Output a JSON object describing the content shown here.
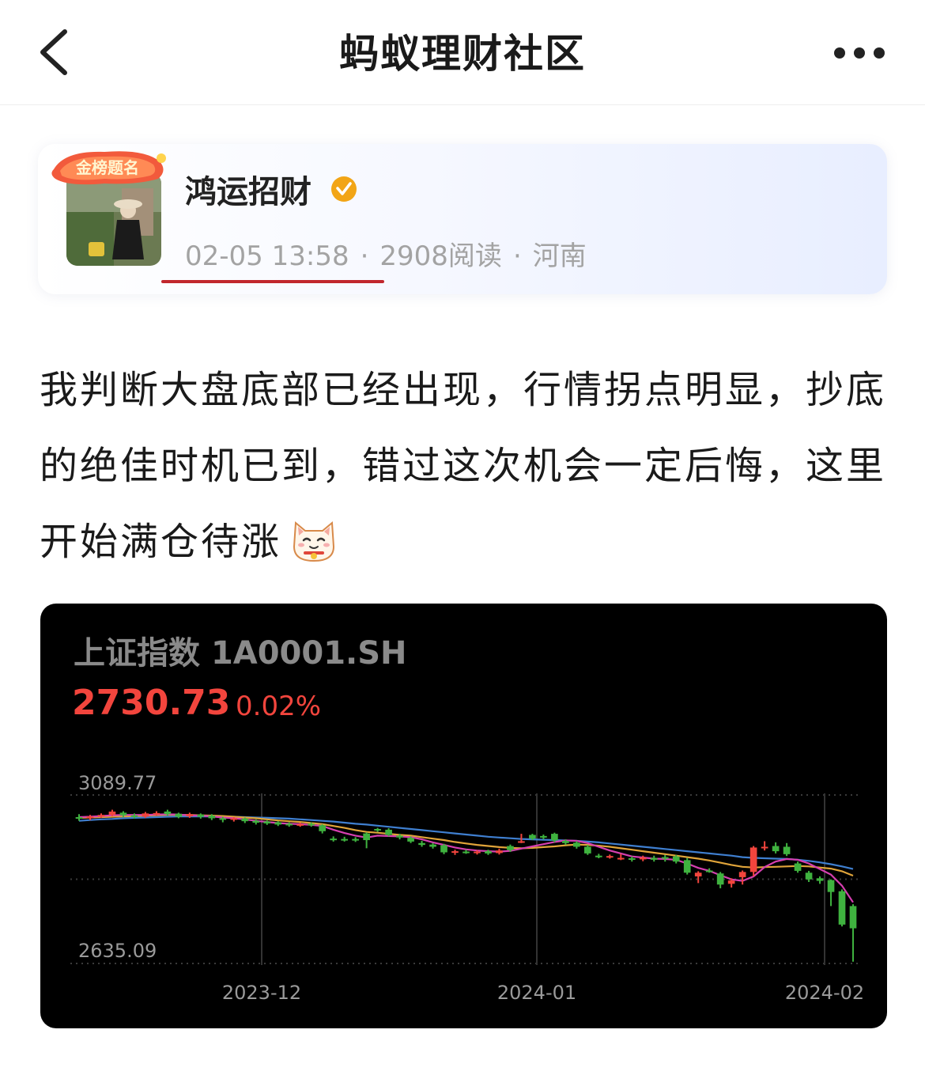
{
  "nav": {
    "title": "蚂蚁理财社区"
  },
  "author": {
    "name": "鸿运招财",
    "badge_text": "金榜题名",
    "date": "02-05 13:58",
    "reads": "2908阅读",
    "location": "河南"
  },
  "post": {
    "text": "我判断大盘底部已经出现，行情拐点明显，抄底的绝佳时机已到，错过这次机会一定后悔，这里开始满仓待涨"
  },
  "stock": {
    "name": "上证指数",
    "code": "1A0001.SH",
    "price": "2730.73",
    "change": "0.02%"
  },
  "colors": {
    "up": "#f2453d",
    "down": "#3fb23f",
    "accent_underline": "#c1272d",
    "ma5": "#d63fb0",
    "ma10": "#e0a43a",
    "ma20": "#3f7fd0"
  },
  "chart_data": {
    "type": "candlestick",
    "y_labels": [
      "3089.77",
      "2635.09"
    ],
    "x_labels": [
      "2023-12",
      "2024-01",
      "2024-02"
    ],
    "ylim": [
      2635.09,
      3089.77
    ],
    "candles": [
      {
        "o": 3030,
        "c": 3027,
        "h": 3038,
        "l": 3020
      },
      {
        "o": 3027,
        "c": 3032,
        "h": 3036,
        "l": 3022
      },
      {
        "o": 3033,
        "c": 3036,
        "h": 3040,
        "l": 3028
      },
      {
        "o": 3036,
        "c": 3045,
        "h": 3050,
        "l": 3032
      },
      {
        "o": 3042,
        "c": 3035,
        "h": 3046,
        "l": 3030
      },
      {
        "o": 3035,
        "c": 3031,
        "h": 3040,
        "l": 3026
      },
      {
        "o": 3031,
        "c": 3040,
        "h": 3044,
        "l": 3028
      },
      {
        "o": 3039,
        "c": 3041,
        "h": 3046,
        "l": 3034
      },
      {
        "o": 3045,
        "c": 3038,
        "h": 3050,
        "l": 3034
      },
      {
        "o": 3039,
        "c": 3031,
        "h": 3042,
        "l": 3027
      },
      {
        "o": 3032,
        "c": 3038,
        "h": 3042,
        "l": 3028
      },
      {
        "o": 3037,
        "c": 3031,
        "h": 3040,
        "l": 3026
      },
      {
        "o": 3034,
        "c": 3027,
        "h": 3038,
        "l": 3022
      },
      {
        "o": 3027,
        "c": 3024,
        "h": 3031,
        "l": 3016
      },
      {
        "o": 3024,
        "c": 3027,
        "h": 3030,
        "l": 3018
      },
      {
        "o": 3026,
        "c": 3019,
        "h": 3029,
        "l": 3014
      },
      {
        "o": 3020,
        "c": 3015,
        "h": 3024,
        "l": 3010
      },
      {
        "o": 3018,
        "c": 3013,
        "h": 3021,
        "l": 3009
      },
      {
        "o": 3016,
        "c": 3010,
        "h": 3019,
        "l": 3006
      },
      {
        "o": 3012,
        "c": 3009,
        "h": 3016,
        "l": 3004
      },
      {
        "o": 3010,
        "c": 3011,
        "h": 3015,
        "l": 3004
      },
      {
        "o": 3012,
        "c": 3008,
        "h": 3016,
        "l": 3004
      },
      {
        "o": 3008,
        "c": 2992,
        "h": 3011,
        "l": 2986
      },
      {
        "o": 2972,
        "c": 2970,
        "h": 2978,
        "l": 2964
      },
      {
        "o": 2971,
        "c": 2969,
        "h": 2977,
        "l": 2964
      },
      {
        "o": 2971,
        "c": 2968,
        "h": 2976,
        "l": 2963
      },
      {
        "o": 2986,
        "c": 2968,
        "h": 2989,
        "l": 2946
      },
      {
        "o": 2998,
        "c": 2996,
        "h": 3001,
        "l": 2990
      },
      {
        "o": 2996,
        "c": 2982,
        "h": 3000,
        "l": 2978
      },
      {
        "o": 2980,
        "c": 2975,
        "h": 2985,
        "l": 2970
      },
      {
        "o": 2974,
        "c": 2964,
        "h": 2978,
        "l": 2960
      },
      {
        "o": 2960,
        "c": 2955,
        "h": 2966,
        "l": 2950
      },
      {
        "o": 2956,
        "c": 2950,
        "h": 2960,
        "l": 2945
      },
      {
        "o": 2954,
        "c": 2935,
        "h": 2958,
        "l": 2930
      },
      {
        "o": 2936,
        "c": 2938,
        "h": 2942,
        "l": 2928
      },
      {
        "o": 2937,
        "c": 2936,
        "h": 2942,
        "l": 2931
      },
      {
        "o": 2934,
        "c": 2937,
        "h": 2941,
        "l": 2929
      },
      {
        "o": 2938,
        "c": 2932,
        "h": 2942,
        "l": 2928
      },
      {
        "o": 2933,
        "c": 2940,
        "h": 2945,
        "l": 2929
      },
      {
        "o": 2952,
        "c": 2941,
        "h": 2956,
        "l": 2936
      },
      {
        "o": 2962,
        "c": 2965,
        "h": 2985,
        "l": 2960
      },
      {
        "o": 2982,
        "c": 2972,
        "h": 2985,
        "l": 2968
      },
      {
        "o": 2979,
        "c": 2976,
        "h": 2983,
        "l": 2970
      },
      {
        "o": 2985,
        "c": 2967,
        "h": 2988,
        "l": 2962
      },
      {
        "o": 2966,
        "c": 2960,
        "h": 2970,
        "l": 2955
      },
      {
        "o": 2961,
        "c": 2950,
        "h": 2965,
        "l": 2945
      },
      {
        "o": 2950,
        "c": 2932,
        "h": 2955,
        "l": 2928
      },
      {
        "o": 2926,
        "c": 2924,
        "h": 2931,
        "l": 2919
      },
      {
        "o": 2923,
        "c": 2925,
        "h": 2929,
        "l": 2918
      },
      {
        "o": 2917,
        "c": 2920,
        "h": 2931,
        "l": 2914
      },
      {
        "o": 2919,
        "c": 2915,
        "h": 2924,
        "l": 2910
      },
      {
        "o": 2916,
        "c": 2921,
        "h": 2926,
        "l": 2911
      },
      {
        "o": 2920,
        "c": 2915,
        "h": 2926,
        "l": 2910
      },
      {
        "o": 2922,
        "c": 2920,
        "h": 2928,
        "l": 2910
      },
      {
        "o": 2924,
        "c": 2910,
        "h": 2928,
        "l": 2905
      },
      {
        "o": 2914,
        "c": 2880,
        "h": 2920,
        "l": 2875
      },
      {
        "o": 2870,
        "c": 2880,
        "h": 2884,
        "l": 2852
      },
      {
        "o": 2886,
        "c": 2884,
        "h": 2892,
        "l": 2880
      },
      {
        "o": 2878,
        "c": 2848,
        "h": 2882,
        "l": 2838
      },
      {
        "o": 2850,
        "c": 2859,
        "h": 2865,
        "l": 2840
      },
      {
        "o": 2868,
        "c": 2882,
        "h": 2886,
        "l": 2848
      },
      {
        "o": 2882,
        "c": 2948,
        "h": 2952,
        "l": 2870
      },
      {
        "o": 2948,
        "c": 2950,
        "h": 2965,
        "l": 2940
      },
      {
        "o": 2952,
        "c": 2938,
        "h": 2962,
        "l": 2932
      },
      {
        "o": 2950,
        "c": 2930,
        "h": 2960,
        "l": 2925
      },
      {
        "o": 2905,
        "c": 2885,
        "h": 2910,
        "l": 2880
      },
      {
        "o": 2880,
        "c": 2862,
        "h": 2885,
        "l": 2855
      },
      {
        "o": 2865,
        "c": 2858,
        "h": 2870,
        "l": 2850
      },
      {
        "o": 2860,
        "c": 2828,
        "h": 2862,
        "l": 2790
      },
      {
        "o": 2830,
        "c": 2740,
        "h": 2835,
        "l": 2735
      },
      {
        "o": 2790,
        "c": 2730,
        "h": 2795,
        "l": 2640
      }
    ],
    "ma5": [
      3030,
      3031,
      3033,
      3035,
      3036,
      3036,
      3036,
      3037,
      3038,
      3037,
      3035,
      3034,
      3032,
      3029,
      3027,
      3024,
      3020,
      3017,
      3014,
      3012,
      3011,
      3009,
      3006,
      2996,
      2987,
      2980,
      2975,
      2980,
      2979,
      2978,
      2976,
      2970,
      2962,
      2955,
      2948,
      2943,
      2940,
      2938,
      2937,
      2939,
      2945,
      2951,
      2957,
      2963,
      2967,
      2966,
      2960,
      2950,
      2940,
      2932,
      2924,
      2921,
      2918,
      2917,
      2915,
      2905,
      2893,
      2885,
      2873,
      2862,
      2858,
      2870,
      2895,
      2910,
      2917,
      2915,
      2905,
      2890,
      2875,
      2845,
      2800
    ],
    "ma10": [
      3028,
      3029,
      3030,
      3031,
      3032,
      3033,
      3034,
      3035,
      3036,
      3036,
      3036,
      3035,
      3034,
      3033,
      3031,
      3029,
      3027,
      3024,
      3021,
      3019,
      3017,
      3014,
      3011,
      3006,
      3001,
      2995,
      2990,
      2988,
      2985,
      2982,
      2980,
      2976,
      2972,
      2968,
      2963,
      2959,
      2955,
      2952,
      2949,
      2947,
      2946,
      2947,
      2949,
      2951,
      2954,
      2956,
      2955,
      2953,
      2950,
      2946,
      2942,
      2938,
      2934,
      2930,
      2926,
      2922,
      2918,
      2913,
      2907,
      2901,
      2896,
      2894,
      2895,
      2896,
      2897,
      2898,
      2897,
      2894,
      2891,
      2884,
      2872
    ],
    "ma20": [
      3020,
      3022,
      3024,
      3025,
      3027,
      3028,
      3029,
      3030,
      3031,
      3032,
      3032,
      3032,
      3032,
      3031,
      3031,
      3030,
      3029,
      3028,
      3027,
      3026,
      3024,
      3022,
      3020,
      3018,
      3015,
      3012,
      3010,
      3007,
      3004,
      3001,
      2998,
      2995,
      2992,
      2989,
      2986,
      2983,
      2980,
      2977,
      2975,
      2973,
      2971,
      2970,
      2969,
      2968,
      2967,
      2966,
      2964,
      2962,
      2959,
      2956,
      2953,
      2950,
      2947,
      2944,
      2941,
      2938,
      2935,
      2932,
      2929,
      2926,
      2922,
      2920,
      2919,
      2918,
      2917,
      2915,
      2912,
      2908,
      2903,
      2897,
      2890
    ]
  }
}
